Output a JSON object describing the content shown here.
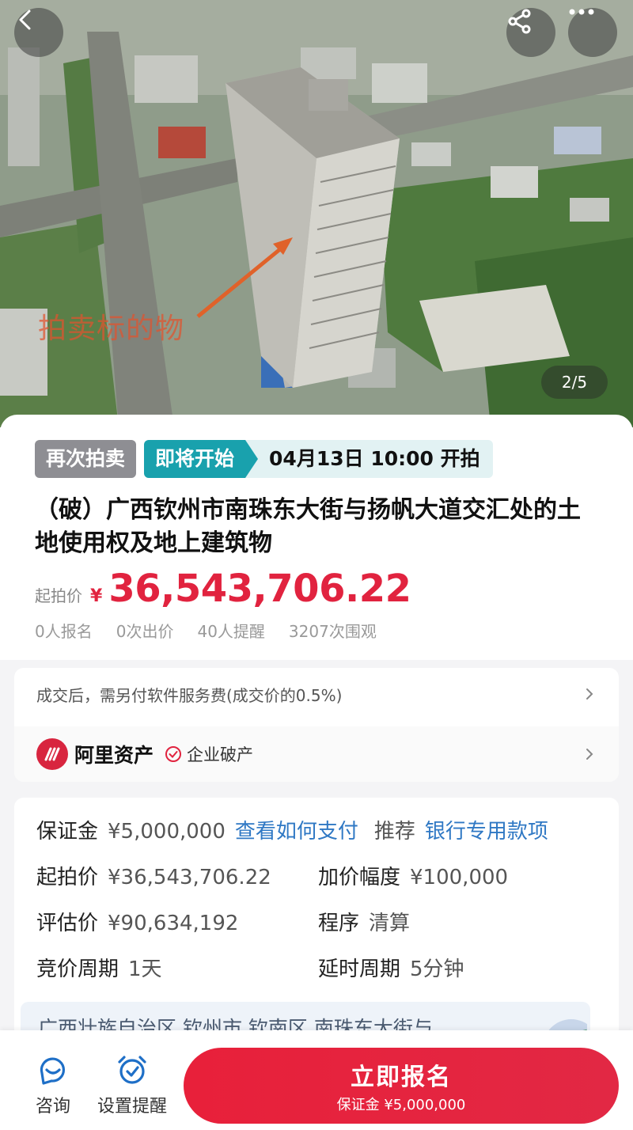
{
  "hero": {
    "annotation_label": "拍卖标的物",
    "pager": "2/5",
    "icons": {
      "back": "back-chevron-icon",
      "share": "share-icon",
      "more": "more-dots-icon"
    }
  },
  "status": {
    "tag_again": "再次拍卖",
    "tag_soon": "即将开始",
    "start_time": "04月13日 10:00 开拍"
  },
  "item": {
    "title": "（破）广西钦州市南珠东大街与扬帆大道交汇处的土地使用权及地上建筑物",
    "start_price_label": "起拍价",
    "currency": "¥",
    "start_price": "36,543,706.22",
    "stats": [
      "0人报名",
      "0次出价",
      "40人提醒",
      "3207次围观"
    ]
  },
  "service": {
    "fee_note": "成交后，需另付软件服务费(成交价的0.5%)",
    "brand_name": "阿里资产",
    "brand_type": "企业破产"
  },
  "details": {
    "deposit_label": "保证金",
    "deposit_value": "¥5,000,000",
    "pay_link": "查看如何支付",
    "recommend_label": "推荐",
    "recommend_link": "银行专用款项",
    "start_price_label": "起拍价",
    "start_price_value": "¥36,543,706.22",
    "increment_label": "加价幅度",
    "increment_value": "¥100,000",
    "appraisal_label": "评估价",
    "appraisal_value": "¥90,634,192",
    "procedure_label": "程序",
    "procedure_value": "清算",
    "period_label": "竞价周期",
    "period_value": "1天",
    "delay_label": "延时周期",
    "delay_value": "5分钟",
    "address": "广西壮族自治区 钦州市 钦南区 南珠东大街与"
  },
  "bottom": {
    "consult_label": "咨询",
    "remind_label": "设置提醒",
    "signup_label": "立即报名",
    "signup_sub": "保证金 ¥5,000,000"
  },
  "colors": {
    "accent_red": "#e1233f",
    "teal": "#19a1ad",
    "link_blue": "#2f78c4"
  }
}
